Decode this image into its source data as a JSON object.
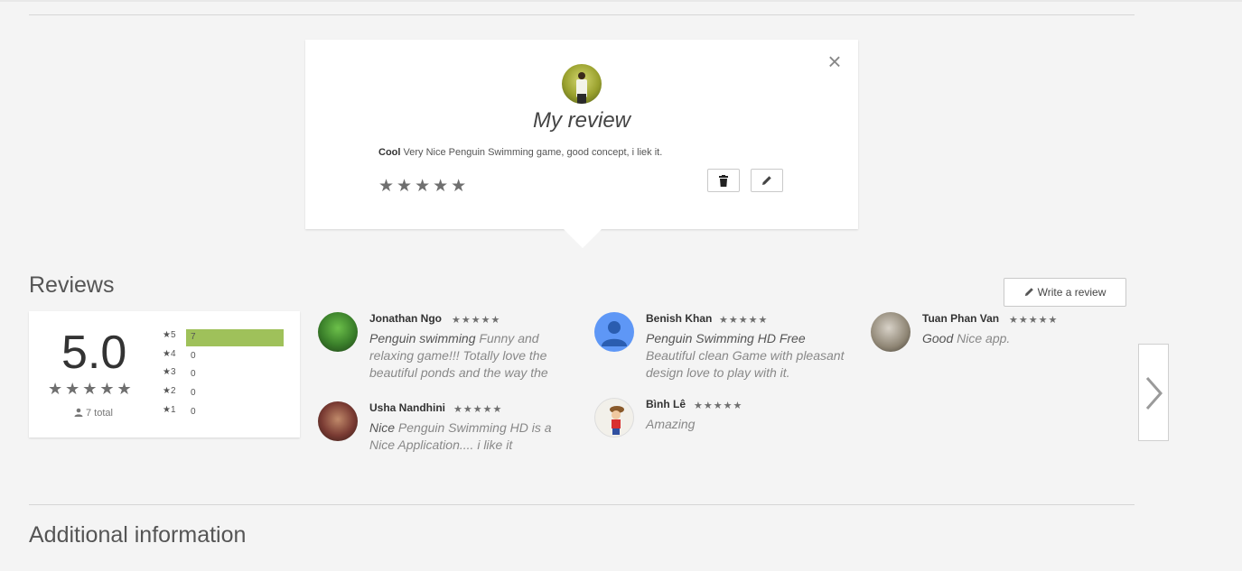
{
  "my_review": {
    "title": "My review",
    "review_title": "Cool",
    "review_body": "Very Nice Penguin Swimming game, good concept, i liek it.",
    "stars": "★★★★★",
    "close_icon": "close-icon",
    "delete_icon": "trash-icon",
    "edit_icon": "pencil-icon"
  },
  "reviews": {
    "heading": "Reviews",
    "write_label": "Write a review",
    "score": "5.0",
    "score_stars": "★★★★★",
    "total": "7 total",
    "histogram": [
      {
        "label": "5",
        "count": "7",
        "fraction": 1.0
      },
      {
        "label": "4",
        "count": "0",
        "fraction": 0
      },
      {
        "label": "3",
        "count": "0",
        "fraction": 0
      },
      {
        "label": "2",
        "count": "0",
        "fraction": 0
      },
      {
        "label": "1",
        "count": "0",
        "fraction": 0
      }
    ],
    "items": [
      {
        "name": "Jonathan Ngo",
        "stars": "★★★★★",
        "title": "Penguin swimming",
        "body": "Funny and relaxing game!!! Totally love the beautiful ponds and the way the"
      },
      {
        "name": "Benish Khan",
        "stars": "★★★★★",
        "title": "Penguin Swimming HD Free",
        "body": "Beautiful clean Game with pleasant design love to play with it."
      },
      {
        "name": "Tuan Phan Van",
        "stars": "★★★★★",
        "title": "Good",
        "body": "Nice app."
      },
      {
        "name": "Usha Nandhini",
        "stars": "★★★★★",
        "title": "Nice",
        "body": "Penguin Swimming HD is a Nice Application.... i like it"
      },
      {
        "name": "Bình Lê",
        "stars": "★★★★★",
        "title": "",
        "body": "Amazing"
      }
    ]
  },
  "additional": {
    "heading": "Additional information"
  },
  "colors": {
    "bar": "#9fc15a",
    "star": "#6f6f6f",
    "background": "#f4f4f4"
  }
}
